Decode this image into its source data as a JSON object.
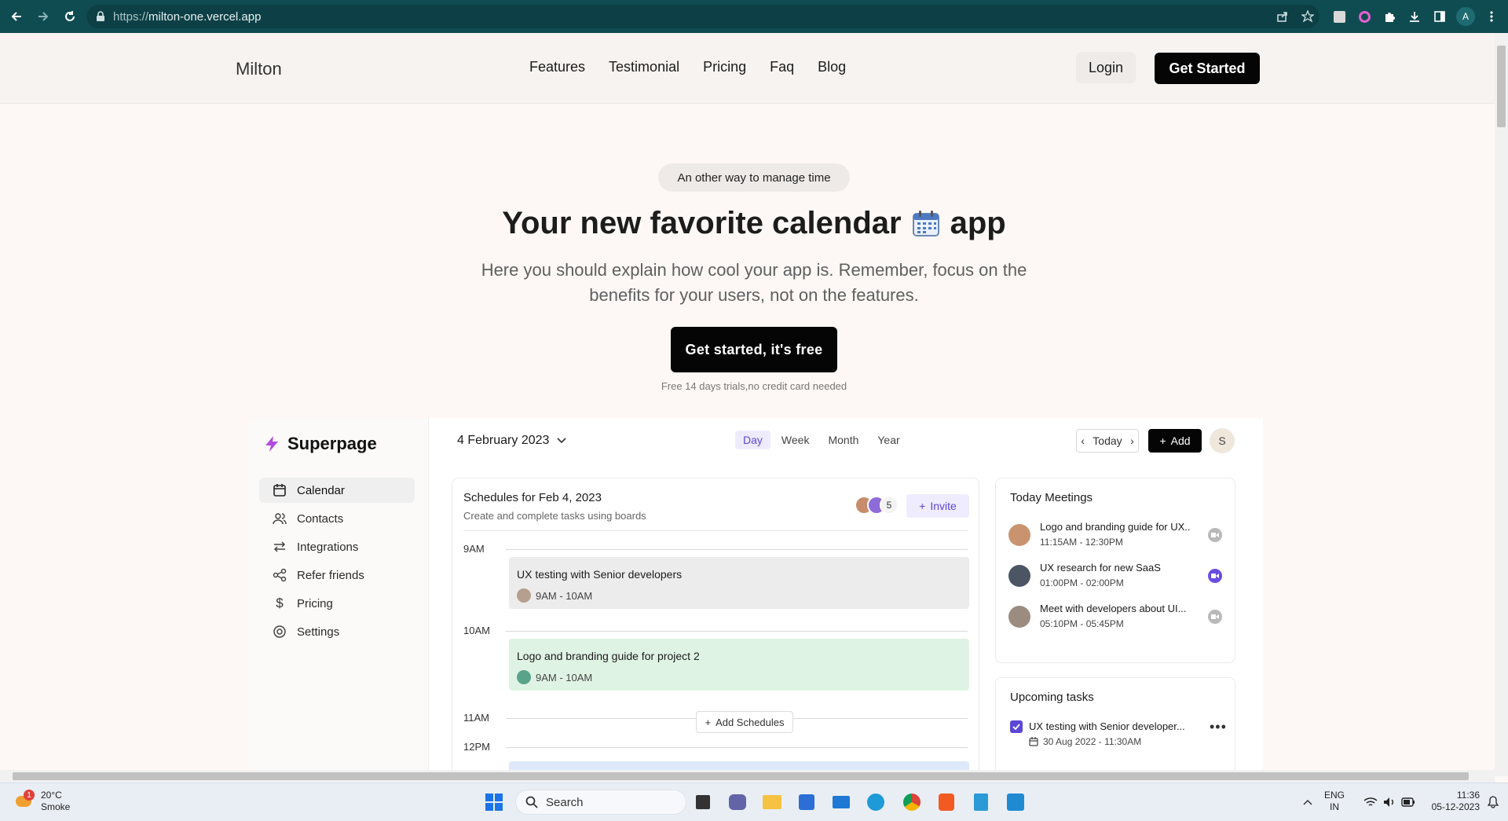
{
  "browser": {
    "url_prefix": "https://",
    "url_host": "milton-one.vercel.app",
    "profile_initial": "A"
  },
  "header": {
    "logo": "Milton",
    "nav": [
      "Features",
      "Testimonial",
      "Pricing",
      "Faq",
      "Blog"
    ],
    "login_label": "Login",
    "get_started_label": "Get Started"
  },
  "hero": {
    "pill": "An other way to manage time",
    "title_before": "Your new favorite calendar",
    "title_after": "app",
    "subtitle": "Here you should explain how cool your app is. Remember, focus on the benefits for your users, not on the features.",
    "cta": "Get started, it's free",
    "cta_note": "Free 14 days trials,no credit card needed"
  },
  "app": {
    "brand": "Superpage",
    "sidebar": [
      "Calendar",
      "Contacts",
      "Integrations",
      "Refer friends",
      "Pricing",
      "Settings"
    ],
    "date": "4 February 2023",
    "views": [
      "Day",
      "Week",
      "Month",
      "Year"
    ],
    "active_view": "Day",
    "today_label": "Today",
    "add_label": "Add",
    "avatar_initial": "S",
    "schedule": {
      "title": "Schedules for Feb 4, 2023",
      "subtitle": "Create and complete tasks using boards",
      "extra_count": "5",
      "invite_label": "Invite",
      "times": [
        "9AM",
        "10AM",
        "11AM",
        "12PM"
      ],
      "events": [
        {
          "title": "UX testing with Senior developers",
          "time": "9AM - 10AM",
          "color": "#ececec"
        },
        {
          "title": "Logo and branding guide for project 2",
          "time": "9AM - 10AM",
          "color": "#dff3e4"
        }
      ],
      "add_schedules_label": "Add Schedules"
    },
    "meetings": {
      "title": "Today Meetings",
      "items": [
        {
          "title": "Logo and branding guide for UX..",
          "time": "11:15AM - 12:30PM",
          "video_color": "#b9b9b9"
        },
        {
          "title": "UX research for new SaaS",
          "time": "01:00PM - 02:00PM",
          "video_color": "#6a4de0"
        },
        {
          "title": "Meet with developers about UI...",
          "time": "05:10PM - 05:45PM",
          "video_color": "#b9b9b9"
        }
      ]
    },
    "tasks": {
      "title": "Upcoming tasks",
      "items": [
        {
          "title": "UX testing with Senior developer...",
          "date": "30 Aug 2022 - 11:30AM"
        }
      ]
    }
  },
  "taskbar": {
    "weather_temp": "20°C",
    "weather_desc": "Smoke",
    "weather_badge": "1",
    "search_label": "Search",
    "lang_top": "ENG",
    "lang_bottom": "IN",
    "time": "11:36",
    "date": "05-12-2023"
  },
  "colors": {
    "browser_chrome": "#0f4c52",
    "accent": "#5b47d6",
    "page_bg": "#fdf8f5"
  }
}
